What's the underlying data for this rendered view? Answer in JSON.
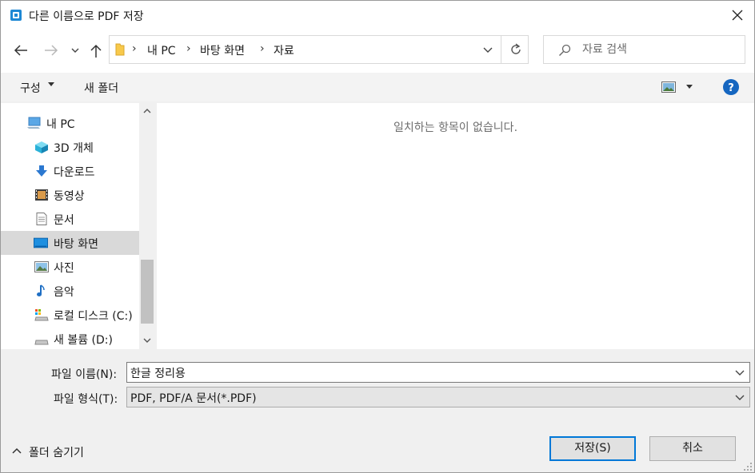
{
  "window": {
    "title": "다른 이름으로 PDF 저장"
  },
  "address_bar": {
    "crumbs": [
      "내 PC",
      "바탕 화면",
      "자료"
    ]
  },
  "search": {
    "placeholder": "자료 검색"
  },
  "commands": {
    "organize": "구성",
    "new_folder": "새 폴더"
  },
  "nav_tree": {
    "items": [
      {
        "label": "내 PC",
        "icon": "computer-icon"
      },
      {
        "label": "3D 개체",
        "icon": "3d-objects-icon"
      },
      {
        "label": "다운로드",
        "icon": "download-icon"
      },
      {
        "label": "동영상",
        "icon": "video-icon"
      },
      {
        "label": "문서",
        "icon": "document-icon"
      },
      {
        "label": "바탕 화면",
        "icon": "desktop-icon",
        "selected": true
      },
      {
        "label": "사진",
        "icon": "pictures-icon"
      },
      {
        "label": "음악",
        "icon": "music-icon"
      },
      {
        "label": "로컬 디스크 (C:)",
        "icon": "local-disk-icon"
      },
      {
        "label": "새 볼륨 (D:)",
        "icon": "drive-icon"
      }
    ]
  },
  "content": {
    "empty_message": "일치하는 항목이 없습니다."
  },
  "form": {
    "filename_label": "파일 이름(N):",
    "filename_value": "한글 정리용",
    "filetype_label": "파일 형식(T):",
    "filetype_value": "PDF, PDF/A 문서(*.PDF)"
  },
  "footer": {
    "hide_folders": "폴더 숨기기",
    "save": "저장(S)",
    "cancel": "취소"
  },
  "colors": {
    "accent": "#0078d7",
    "selected_item": "#d9d9d9",
    "folder_yellow": "#f8c94b"
  }
}
